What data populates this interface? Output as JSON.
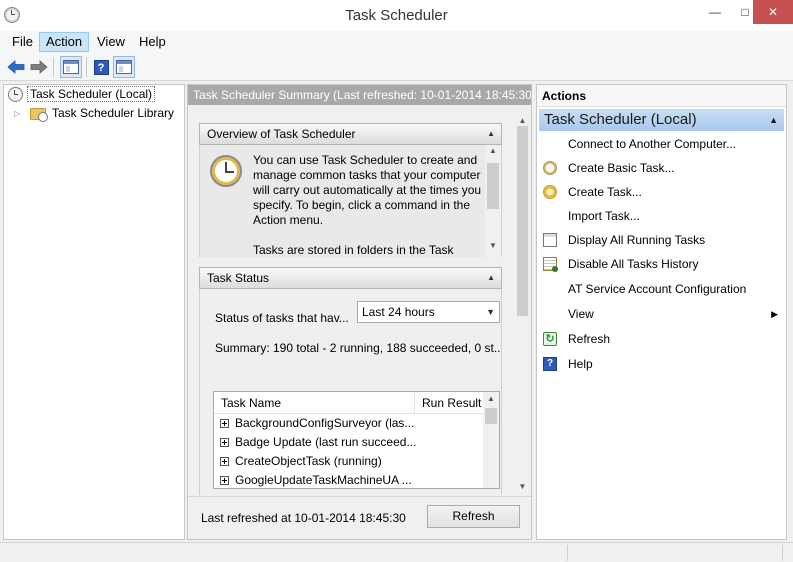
{
  "window": {
    "title": "Task Scheduler",
    "controls": {
      "minimize": "—",
      "maximize": "□",
      "close": "✕"
    }
  },
  "menu": [
    {
      "label": "File",
      "active": false
    },
    {
      "label": "Action",
      "active": true
    },
    {
      "label": "View",
      "active": false
    },
    {
      "label": "Help",
      "active": false
    }
  ],
  "toolbar": {
    "back_icon": "arrow-left-icon",
    "forward_icon": "arrow-right-icon",
    "help_glyph": "?"
  },
  "tree": {
    "root_label": "Task Scheduler (Local)",
    "child_label": "Task Scheduler Library",
    "child_expander": "▷"
  },
  "center": {
    "header": "Task Scheduler Summary (Last refreshed: 10-01-2014 18:45:30)",
    "overview": {
      "title": "Overview of Task Scheduler",
      "paragraph1": "You can use Task Scheduler to create and manage common tasks that your computer will carry out automatically at the times you specify. To begin, click a command in the Action menu.",
      "paragraph2": "Tasks are stored in folders in the Task"
    },
    "task_status": {
      "title": "Task Status",
      "status_label": "Status of tasks that hav...",
      "period_selected": "Last 24 hours",
      "summary": "Summary: 190 total - 2 running, 188 succeeded, 0 st...",
      "columns": [
        "Task Name",
        "Run Result"
      ],
      "rows": [
        "BackgroundConfigSurveyor (las...",
        "Badge Update (last run succeed...",
        "CreateObjectTask (running)",
        "GoogleUpdateTaskMachineUA ..."
      ]
    },
    "footer": {
      "last_refreshed": "Last refreshed at 10-01-2014 18:45:30",
      "refresh_button": "Refresh"
    }
  },
  "actions": {
    "title": "Actions",
    "group": "Task Scheduler (Local)",
    "items": [
      {
        "label": "Connect to Another Computer...",
        "icon": ""
      },
      {
        "label": "Create Basic Task...",
        "icon": "create-basic-task-icon"
      },
      {
        "label": "Create Task...",
        "icon": "create-task-icon"
      },
      {
        "label": "Import Task...",
        "icon": ""
      },
      {
        "label": "Display All Running Tasks",
        "icon": "running-tasks-icon"
      },
      {
        "label": "Disable All Tasks History",
        "icon": "tasks-history-icon"
      },
      {
        "label": "AT Service Account Configuration",
        "icon": ""
      },
      {
        "label": "View",
        "icon": "",
        "submenu": true
      },
      {
        "label": "Refresh",
        "icon": "refresh-icon"
      },
      {
        "label": "Help",
        "icon": "help-icon"
      }
    ]
  },
  "colors": {
    "actions_group_bg": "#b7d1ef",
    "center_header_bg": "#a8a8a8",
    "close_button": "#c75050"
  }
}
